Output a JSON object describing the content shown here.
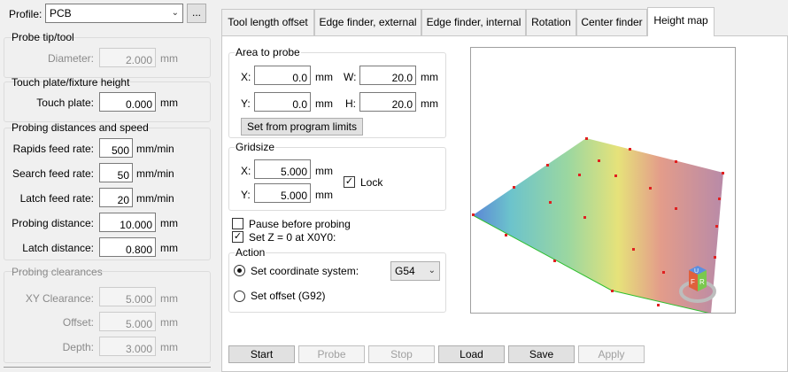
{
  "profile": {
    "label": "Profile:",
    "value": "PCB",
    "browse_label": "..."
  },
  "probe_tip": {
    "title": "Probe tip/tool",
    "diameter_label": "Diameter:",
    "diameter_value": "2.000",
    "diameter_unit": "mm"
  },
  "touch_plate": {
    "title": "Touch plate/fixture height",
    "label": "Touch plate:",
    "value": "0.000",
    "unit": "mm"
  },
  "probing": {
    "title": "Probing distances and speed",
    "rapids_label": "Rapids feed rate:",
    "rapids_value": "500",
    "rapids_unit": "mm/min",
    "search_label": "Search feed rate:",
    "search_value": "50",
    "search_unit": "mm/min",
    "latch_feed_label": "Latch feed rate:",
    "latch_feed_value": "20",
    "latch_feed_unit": "mm/min",
    "probing_dist_label": "Probing distance:",
    "probing_dist_value": "10.000",
    "probing_dist_unit": "mm",
    "latch_dist_label": "Latch distance:",
    "latch_dist_value": "0.800",
    "latch_dist_unit": "mm"
  },
  "clearances": {
    "title": "Probing clearances",
    "xy_label": "XY Clearance:",
    "xy_value": "5.000",
    "xy_unit": "mm",
    "offset_label": "Offset:",
    "offset_value": "5.000",
    "offset_unit": "mm",
    "depth_label": "Depth:",
    "depth_value": "3.000",
    "depth_unit": "mm"
  },
  "tabs": [
    {
      "label": "Tool length offset"
    },
    {
      "label": "Edge finder, external"
    },
    {
      "label": "Edge finder, internal"
    },
    {
      "label": "Rotation"
    },
    {
      "label": "Center finder"
    },
    {
      "label": "Height map"
    }
  ],
  "area": {
    "title": "Area to probe",
    "x_label": "X:",
    "x_value": "0.0",
    "x_unit": "mm",
    "w_label": "W:",
    "w_value": "20.0",
    "w_unit": "mm",
    "y_label": "Y:",
    "y_value": "0.0",
    "y_unit": "mm",
    "h_label": "H:",
    "h_value": "20.0",
    "h_unit": "mm",
    "set_button": "Set from program limits"
  },
  "gridsize": {
    "title": "Gridsize",
    "x_label": "X:",
    "x_value": "5.000",
    "x_unit": "mm",
    "y_label": "Y:",
    "y_value": "5.000",
    "y_unit": "mm",
    "lock_label": "Lock",
    "lock_checked": true
  },
  "options": {
    "pause_label": "Pause before probing",
    "pause_checked": false,
    "setz_label": "Set Z = 0 at X0Y0:",
    "setz_checked": true
  },
  "action": {
    "title": "Action",
    "coord_label": "Set coordinate system:",
    "coord_value": "G54",
    "offset_label": "Set offset (G92)"
  },
  "buttons": {
    "start": "Start",
    "probe": "Probe",
    "stop": "Stop",
    "load": "Load",
    "save": "Save",
    "apply": "Apply"
  },
  "view_cube": {
    "top": "U",
    "front": "F",
    "right": "R"
  },
  "colors": {
    "surface_low": "#5b9bd5",
    "surface_mid": "#e6e27a",
    "surface_high": "#c7849e",
    "probe_point": "#e02020",
    "edge_line": "#2fbf2f"
  }
}
